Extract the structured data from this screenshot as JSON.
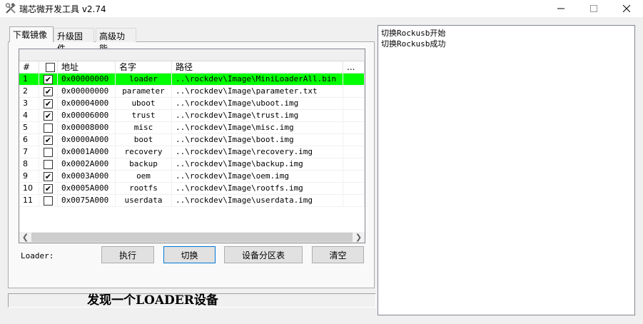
{
  "window": {
    "title": "瑞芯微开发工具 v2.74"
  },
  "tabs": [
    {
      "label": "下载镜像"
    },
    {
      "label": "升级固件"
    },
    {
      "label": "高级功能"
    }
  ],
  "table": {
    "headers": [
      "#",
      "",
      "地址",
      "名字",
      "路径",
      "..."
    ],
    "rows": [
      {
        "num": "1",
        "checked": true,
        "addr": "0x00000000",
        "name": "loader",
        "path": "..\\rockdev\\Image\\MiniLoaderAll.bin",
        "highlight": true
      },
      {
        "num": "2",
        "checked": true,
        "addr": "0x00000000",
        "name": "parameter",
        "path": "..\\rockdev\\Image\\parameter.txt",
        "highlight": false
      },
      {
        "num": "3",
        "checked": true,
        "addr": "0x00004000",
        "name": "uboot",
        "path": "..\\rockdev\\Image\\uboot.img",
        "highlight": false
      },
      {
        "num": "4",
        "checked": true,
        "addr": "0x00006000",
        "name": "trust",
        "path": "..\\rockdev\\Image\\trust.img",
        "highlight": false
      },
      {
        "num": "5",
        "checked": false,
        "addr": "0x00008000",
        "name": "misc",
        "path": "..\\rockdev\\Image\\misc.img",
        "highlight": false
      },
      {
        "num": "6",
        "checked": true,
        "addr": "0x0000A000",
        "name": "boot",
        "path": "..\\rockdev\\Image\\boot.img",
        "highlight": false
      },
      {
        "num": "7",
        "checked": false,
        "addr": "0x0001A000",
        "name": "recovery",
        "path": "..\\rockdev\\Image\\recovery.img",
        "highlight": false
      },
      {
        "num": "8",
        "checked": false,
        "addr": "0x0002A000",
        "name": "backup",
        "path": "..\\rockdev\\Image\\backup.img",
        "highlight": false
      },
      {
        "num": "9",
        "checked": true,
        "addr": "0x0003A000",
        "name": "oem",
        "path": "..\\rockdev\\Image\\oem.img",
        "highlight": false
      },
      {
        "num": "10",
        "checked": true,
        "addr": "0x0005A000",
        "name": "rootfs",
        "path": "..\\rockdev\\Image\\rootfs.img",
        "highlight": false
      },
      {
        "num": "11",
        "checked": false,
        "addr": "0x0075A000",
        "name": "userdata",
        "path": "..\\rockdev\\Image\\userdata.img",
        "highlight": false
      }
    ],
    "highlight_color": "#00ff00"
  },
  "loader_label": "Loader:",
  "buttons": {
    "execute": "执行",
    "switch": "切换",
    "device_partition": "设备分区表",
    "clear": "清空"
  },
  "status_text": "发现一个LOADER设备",
  "log_lines": [
    "切换Rockusb开始",
    "切换Rockusb成功"
  ],
  "icons": {
    "app": "tools-icon",
    "min": "minimize-icon",
    "max": "maximize-icon",
    "close": "close-icon"
  }
}
